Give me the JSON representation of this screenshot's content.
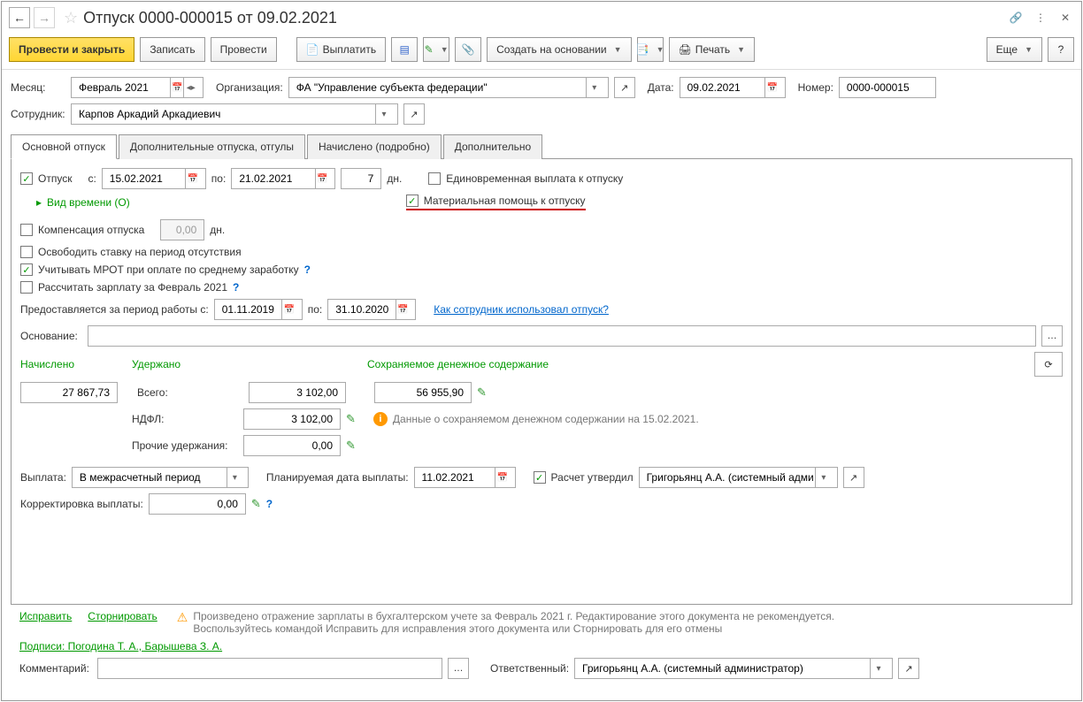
{
  "title": "Отпуск 0000-000015 от 09.02.2021",
  "toolbar": {
    "save_close": "Провести и закрыть",
    "write": "Записать",
    "post": "Провести",
    "pay": "Выплатить",
    "create_based": "Создать на основании",
    "print": "Печать",
    "more": "Еще",
    "help": "?"
  },
  "header": {
    "month_label": "Месяц:",
    "month_value": "Февраль 2021",
    "org_label": "Организация:",
    "org_value": "ФА \"Управление субъекта федерации\"",
    "date_label": "Дата:",
    "date_value": "09.02.2021",
    "number_label": "Номер:",
    "number_value": "0000-000015",
    "emp_label": "Сотрудник:",
    "emp_value": "Карпов Аркадий Аркадиевич"
  },
  "tabs": {
    "t1": "Основной отпуск",
    "t2": "Дополнительные отпуска, отгулы",
    "t3": "Начислено (подробно)",
    "t4": "Дополнительно"
  },
  "main": {
    "vacation_label": "Отпуск",
    "from_label": "с:",
    "from_value": "15.02.2021",
    "to_label": "по:",
    "to_value": "21.02.2021",
    "days_value": "7",
    "days_unit": "дн.",
    "lump_sum": "Единовременная выплата к отпуску",
    "mat_help": "Материальная помощь к отпуску",
    "time_type": "Вид времени (О)",
    "compensation": "Компенсация отпуска",
    "comp_value": "0,00",
    "comp_unit": "дн.",
    "release_rate": "Освободить ставку на период отсутствия",
    "mrot": "Учитывать МРОТ при оплате по среднему заработку",
    "calc_salary": "Рассчитать зарплату за Февраль 2021",
    "period_label": "Предоставляется за период работы с:",
    "period_from": "01.11.2019",
    "period_to_label": "по:",
    "period_to": "31.10.2020",
    "usage_link": "Как сотрудник использовал отпуск?",
    "basis_label": "Основание:",
    "accrued_h": "Начислено",
    "withheld_h": "Удержано",
    "kept_h": "Сохраняемое денежное содержание",
    "accrued_val": "27 867,73",
    "total_label": "Всего:",
    "total_val": "3 102,00",
    "kept_val": "56 955,90",
    "ndfl_label": "НДФЛ:",
    "ndfl_val": "3 102,00",
    "other_label": "Прочие удержания:",
    "other_val": "0,00",
    "info_text": "Данные о сохраняемом денежном содержании на 15.02.2021.",
    "payout_label": "Выплата:",
    "payout_val": "В межрасчетный период",
    "planned_label": "Планируемая дата выплаты:",
    "planned_val": "11.02.2021",
    "approved_label": "Расчет утвердил",
    "approved_val": "Григорьянц А.А. (системный адми",
    "correction_label": "Корректировка выплаты:",
    "correction_val": "0,00"
  },
  "footer": {
    "fix_link": "Исправить",
    "storno_link": "Сторнировать",
    "warn_text1": "Произведено отражение зарплаты в бухгалтерском учете за Февраль 2021 г. Редактирование этого документа не рекомендуется.",
    "warn_text2": "Воспользуйтесь командой Исправить для исправления этого документа или Сторнировать для его отмены",
    "signs": "Подписи: Погодина Т. А., Барышева З. А.",
    "comment_label": "Комментарий:",
    "resp_label": "Ответственный:",
    "resp_val": "Григорьянц А.А. (системный администратор)"
  }
}
